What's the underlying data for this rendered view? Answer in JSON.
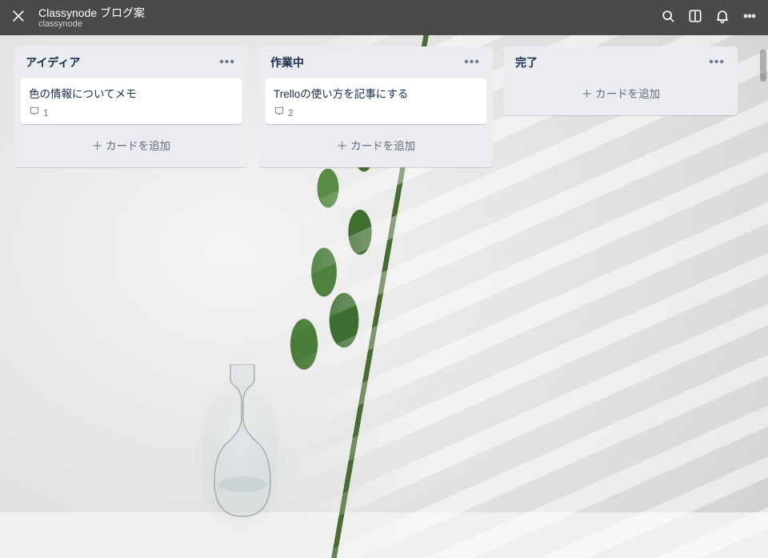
{
  "header": {
    "board_title": "Classynode ブログ案",
    "team_name": "classynode"
  },
  "add_card_label": "＋ カードを追加",
  "lists": [
    {
      "title": "アイディア",
      "cards": [
        {
          "title": "色の情報についてメモ",
          "comment_count": "1"
        }
      ]
    },
    {
      "title": "作業中",
      "cards": [
        {
          "title": "Trelloの使い方を記事にする",
          "comment_count": "2"
        }
      ]
    },
    {
      "title": "完了",
      "cards": []
    }
  ]
}
